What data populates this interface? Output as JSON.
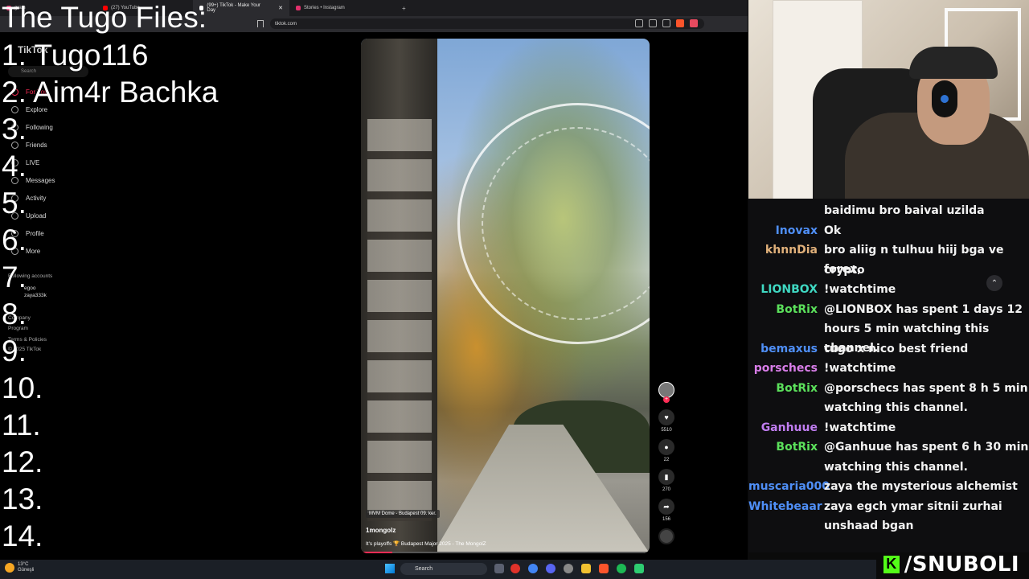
{
  "browser": {
    "tabs": [
      {
        "label": "gram",
        "color": "#e1306c"
      },
      {
        "label": "(27) YouTube",
        "color": "#ff0000"
      },
      {
        "label": "(99+) TikTok - Make Your Day",
        "color": "#ffffff",
        "active": true
      },
      {
        "label": "Stories • Instagram",
        "color": "#e1306c"
      }
    ],
    "url": "tiktok.com"
  },
  "tiktok": {
    "logo": "TikTok",
    "search_placeholder": "Search",
    "nav": [
      "For You",
      "Explore",
      "Following",
      "Friends",
      "LIVE",
      "Messages",
      "Activity",
      "Upload",
      "Profile",
      "More"
    ],
    "following_header": "Following accounts",
    "following": [
      "egoo",
      "zaya333k"
    ],
    "footer": [
      "Company",
      "Program",
      "Terms & Policies",
      "© 2025 TikTok"
    ]
  },
  "overlay": {
    "title": "The Tugo Files:",
    "items": [
      "1. Tugo116",
      "2.  Aim4r Bachka",
      "3.",
      "4.",
      "5.",
      "6.",
      "7.",
      "8.",
      "9.",
      "10.",
      "11.",
      "12.",
      "13.",
      "14."
    ]
  },
  "video": {
    "location": "MVM Dome - Budapest 09. ker.",
    "username": "1mongolz",
    "caption": "It's playoffs 🏆 Budapest Major 2025 - The MongolZ",
    "progress_fraction": 0.11,
    "likes": "5510",
    "comments": "22",
    "saves": "270",
    "shares": "156"
  },
  "chat": {
    "messages": [
      {
        "user": "",
        "color": "#ffffff",
        "text": "baidimu bro baival uzilda"
      },
      {
        "user": "Inovax",
        "color": "#4f8ff7",
        "text": "Ok"
      },
      {
        "user": "khnnDia",
        "color": "#e0b07a",
        "text": "bro aliig n tulhuu hiij bga ve forex,"
      },
      {
        "user": "",
        "color": "#ffffff",
        "text": "crypto"
      },
      {
        "user": "LIONBOX",
        "color": "#3fd8c2",
        "text": "!watchtime"
      },
      {
        "user": "BotRix",
        "color": "#5be05b",
        "text": "@LIONBOX has spent 1 days 12"
      },
      {
        "user": "",
        "color": "#ffffff",
        "text": "hours 5 min watching this channel."
      },
      {
        "user": "bemaxus",
        "color": "#4f8ff7",
        "text": "tugo x nico best friend"
      },
      {
        "user": "porschecs",
        "color": "#d87de8",
        "text": "!watchtime"
      },
      {
        "user": "BotRix",
        "color": "#5be05b",
        "text": "@porschecs has spent 8 h 5 min"
      },
      {
        "user": "",
        "color": "#ffffff",
        "text": "watching this channel."
      },
      {
        "user": "Ganhuue",
        "color": "#c07df0",
        "text": "!watchtime"
      },
      {
        "user": "BotRix",
        "color": "#5be05b",
        "text": "@Ganhuue has spent 6 h 30 min"
      },
      {
        "user": "",
        "color": "#ffffff",
        "text": "watching this channel."
      },
      {
        "user": "muscaria000",
        "color": "#4f8ff7",
        "text": "zaya the mysterious alchemist"
      },
      {
        "user": "Whitebeaar",
        "color": "#4f8ff7",
        "text": "zaya egch ymar sitnii zurhai"
      },
      {
        "user": "",
        "color": "#ffffff",
        "text": "unshaad bgan"
      }
    ]
  },
  "brand": {
    "letter": "K",
    "name": "/SNUBOLI",
    "color": "#53fc18"
  },
  "taskbar": {
    "temp": "13°C",
    "weather": "Güneşli",
    "search": "Search"
  }
}
